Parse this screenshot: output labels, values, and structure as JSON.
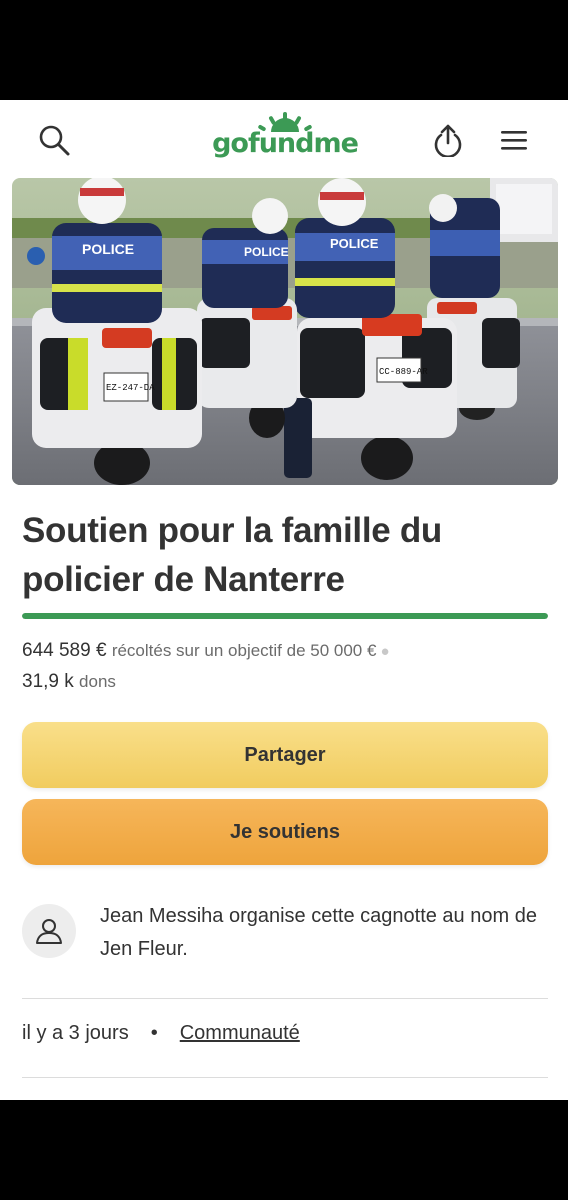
{
  "header": {
    "logo_text": "gofundme",
    "icons": [
      "search-icon",
      "share-upload-icon",
      "menu-icon"
    ]
  },
  "campaign": {
    "title": "Soutien pour la famille du policier de Nanterre",
    "raised": "644 589 €",
    "raised_suffix": "récoltés sur un objectif de 50 000 €",
    "donations_count": "31,9 k",
    "donations_label": "dons",
    "progress_fraction": 1.0
  },
  "actions": {
    "share_label": "Partager",
    "donate_label": "Je soutiens"
  },
  "organizer": {
    "text": "Jean Messiha organise cette cagnotte au nom de Jen Fleur."
  },
  "meta": {
    "posted": "il y a 3 jours",
    "category": "Communauté"
  },
  "hero_image": {
    "plates": [
      "EZ-247-DA",
      "CC-889-AR"
    ],
    "vest_text": "POLICE"
  },
  "colors": {
    "brand": "#3c9a55",
    "share_button": "#f1cc5f",
    "donate_button": "#eea43c"
  }
}
